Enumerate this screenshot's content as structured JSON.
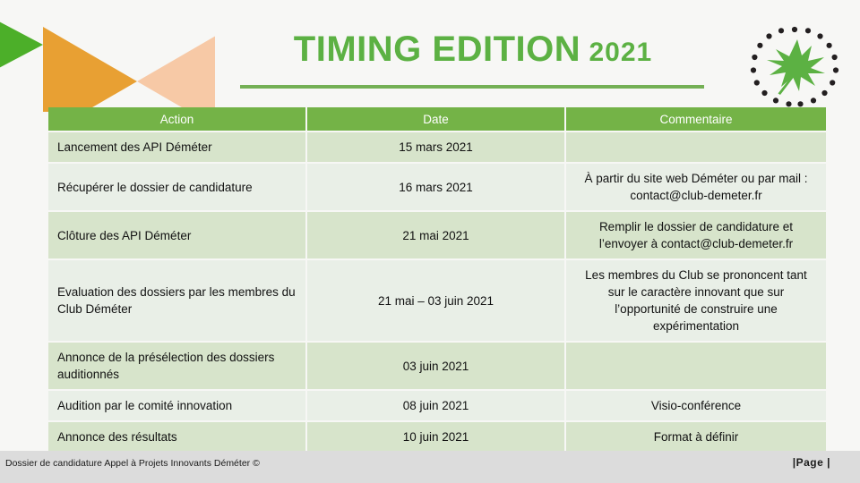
{
  "header": {
    "title_main": "TIMING EDITION",
    "title_year": "2021",
    "logo_name": "demeter-leaf-logo",
    "accent_green": "#5CB143",
    "rule_green": "#74b055"
  },
  "decor": {
    "triangle_green_dark": "#4CAF29",
    "triangle_green_pale": "#cfe3c0",
    "triangle_orange": "#E8A033",
    "triangle_peach": "#F7C9A6"
  },
  "table": {
    "header_bg": "#74b347",
    "row_tint_bg": "#d7e4cb",
    "row_plain_bg": "#e9efe7",
    "columns": [
      "Action",
      "Date",
      "Commentaire"
    ],
    "rows": [
      {
        "action": "Lancement des API Déméter",
        "date": "15 mars 2021",
        "commentaire": ""
      },
      {
        "action": "Récupérer le dossier de candidature",
        "date": "16 mars 2021",
        "commentaire": "À partir du site web Déméter ou par mail : contact@club-demeter.fr"
      },
      {
        "action": "Clôture des API Déméter",
        "date": "21 mai 2021",
        "commentaire": "Remplir le dossier de candidature et l’envoyer à contact@club-demeter.fr"
      },
      {
        "action": "Evaluation des dossiers par les membres du Club Déméter",
        "date": "21 mai – 03 juin 2021",
        "commentaire": "Les membres du Club se prononcent tant sur le caractère innovant que sur l’opportunité de construire une expérimentation"
      },
      {
        "action": "Annonce de la présélection des dossiers auditionnés",
        "date": "03 juin 2021",
        "commentaire": ""
      },
      {
        "action": "Audition par le comité innovation",
        "date": "08 juin 2021",
        "commentaire": "Visio-conférence"
      },
      {
        "action": "Annonce des résultats",
        "date": "10 juin 2021",
        "commentaire": "Format à définir"
      }
    ]
  },
  "footer": {
    "left_text": "Dossier de candidature Appel à Projets Innovants Déméter ©",
    "right_text": "|Page |",
    "background": "#dcdcdc"
  }
}
